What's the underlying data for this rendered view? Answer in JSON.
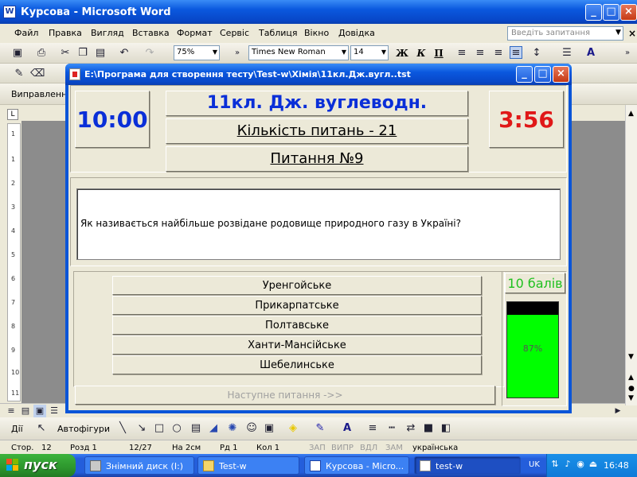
{
  "word": {
    "title": "Курсова - Microsoft Word",
    "menu": [
      "Файл",
      "Правка",
      "Вигляд",
      "Вставка",
      "Формат",
      "Сервіс",
      "Таблиця",
      "Вікно",
      "Довідка"
    ],
    "help_placeholder": "Введіть запитання",
    "zoom": "75%",
    "font_name": "Times New Roman",
    "font_size": "14",
    "bold": "Ж",
    "italic": "К",
    "underline": "П",
    "review_label": "Виправлення",
    "draw_label": "Дії",
    "autoshapes_label": "Автофігури",
    "status": {
      "page": "Стор.",
      "page_num": "12",
      "section": "Розд 1",
      "page_of": "12/27",
      "at": "На 2см",
      "line": "Рд 1",
      "col": "Кол 1",
      "rec": "ЗАП",
      "trk": "ВИПР",
      "ext": "ВДЛ",
      "ovr": "ЗАМ",
      "lang": "українська"
    },
    "ruler_ticks": [
      "1",
      "2",
      "3",
      "4",
      "5",
      "6",
      "7",
      "8",
      "9",
      "10",
      "11"
    ]
  },
  "dialog": {
    "title": "E:\\Програма для створення тесту\\Test-w\\Хімія\\11кл.Дж.вугл..tst",
    "time_limit": "10:00",
    "time_left": "3:56",
    "test_title": "11кл. Дж. вуглеводн.",
    "question_count": "Кількість питань - 21",
    "question_number": "Питання №9",
    "question": "Як називається найбільше розвідане родовище природного газу в Україні?",
    "answers": [
      "Уренгойське",
      "Прикарпатське",
      "Полтавське",
      "Ханти-Мансійське",
      "Шебелинське"
    ],
    "score": "10 балів",
    "progress_label": "87%",
    "progress_fraction": 0.87,
    "next_label": "Наступне питання ->>"
  },
  "taskbar": {
    "start": "пуск",
    "tasks": [
      "Знімний диск (I:)",
      "Test-w",
      "Курсова - Micro...",
      "test-w"
    ],
    "lang": "UK",
    "clock": "16:48"
  },
  "colors": {
    "title_blue": "#0a2fd8",
    "time_left_red": "#e01818",
    "score_green": "#1ec01e",
    "gauge_green": "#00ff00"
  }
}
